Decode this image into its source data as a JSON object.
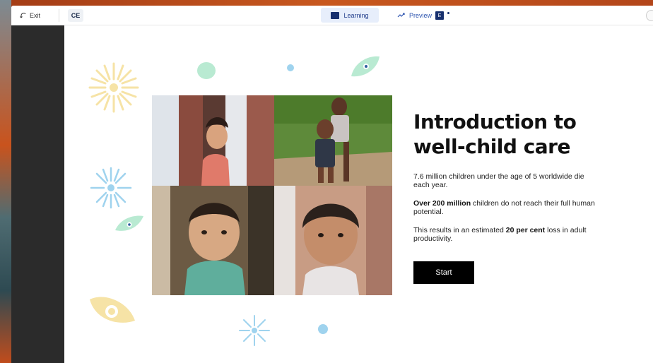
{
  "toolbar": {
    "exit_label": "Exit",
    "collapse_label": "CE",
    "learning_label": "Learning",
    "preview_label": "Preview",
    "preview_badge": "E"
  },
  "main": {
    "title_line1": "Introduction to",
    "title_line2": "well-child care",
    "para1": "7.6 million children under the age of 5 worldwide die each year.",
    "para2_bold": "Over 200 million",
    "para2_rest": " children do not reach their full human potential.",
    "para3_pre": "This results in an estimated ",
    "para3_bold": "20 per cent",
    "para3_post": " loss in adult productivity.",
    "start_label": "Start"
  },
  "colors": {
    "accent_dark": "#17306e",
    "button_bg": "#000000",
    "deco_yellow": "#f6e3a6",
    "deco_blue": "#9fd3ee",
    "deco_green": "#b9ead2"
  },
  "icons": [
    "back-arrow-icon",
    "collapse-icon",
    "learning-icon",
    "preview-icon"
  ]
}
